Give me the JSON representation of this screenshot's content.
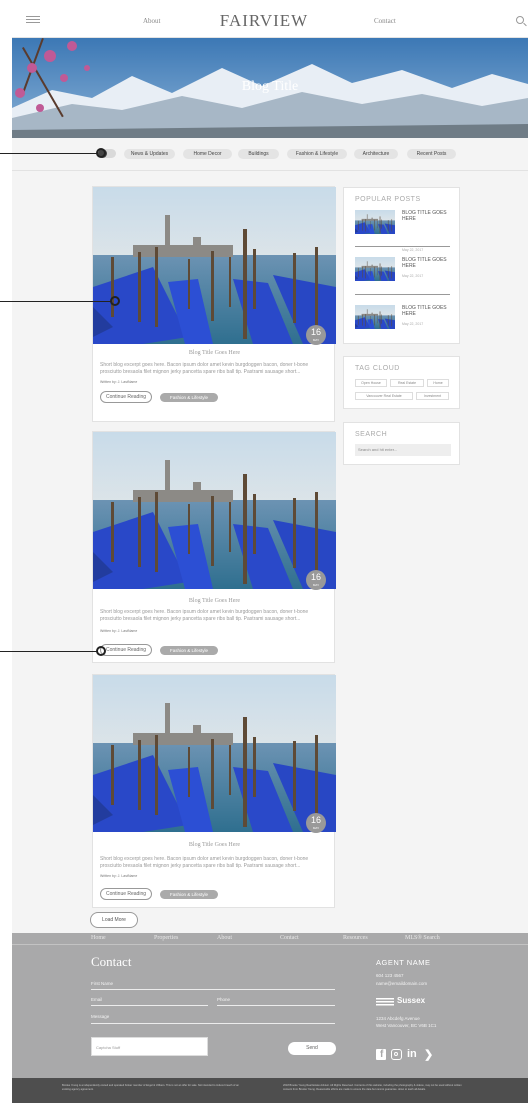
{
  "header": {
    "logo": "FAIRVIEW",
    "nav_left": "About",
    "nav_right": "Contact"
  },
  "hero": {
    "title": "Blog Title"
  },
  "filters": [
    "News & Updates",
    "Home Decor",
    "Buildings",
    "Fashion & Lifestyle",
    "Architecture",
    "Recent Posts"
  ],
  "posts": [
    {
      "title": "Blog Title Goes Here",
      "excerpt": "Short blog excerpt goes here. Bacon ipsum dolor amet kevin burgdoggen bacon, doner t-bone prosciutto bresaola filet mignon jerky pancetta spare ribs ball tip. Pastrami sausage short...",
      "author": "Written by: J. LastName",
      "day": "16",
      "month": "MAY",
      "button": "Continue Reading",
      "tag": "Fashion & Lifestyle"
    },
    {
      "title": "Blog Title Goes Here",
      "excerpt": "Short blog excerpt goes here. Bacon ipsum dolor amet kevin burgdoggen bacon, doner t-bone prosciutto bresaola filet mignon jerky pancetta spare ribs ball tip. Pastrami sausage short...",
      "author": "Written by: J. LastName",
      "day": "16",
      "month": "MAY",
      "button": "Continue Reading",
      "tag": "Fashion & Lifestyle"
    },
    {
      "title": "Blog Title Goes Here",
      "excerpt": "Short blog excerpt goes here. Bacon ipsum dolor amet kevin burgdoggen bacon, doner t-bone prosciutto bresaola filet mignon jerky pancetta spare ribs ball tip. Pastrami sausage short...",
      "author": "Written by: J. LastName",
      "day": "16",
      "month": "MAY",
      "button": "Continue Reading",
      "tag": "Fashion & Lifestyle"
    }
  ],
  "sidebar": {
    "popular_title": "POPULAR POSTS",
    "popular": [
      {
        "title": "BLOG TITLE GOES HERE",
        "date": "May 22, 2017"
      },
      {
        "title": "BLOG TITLE GOES HERE",
        "date": "May 22, 2017"
      },
      {
        "title": "BLOG TITLE GOES HERE",
        "date": "May 22, 2017"
      }
    ],
    "tag_cloud_title": "TAG CLOUD",
    "tags": [
      "Open House",
      "Real Estate",
      "Home",
      "Vancouver Real Estate",
      "Investment"
    ],
    "search_title": "SEARCH",
    "search_placeholder": "Search and hit enter..."
  },
  "load_more": "Load More",
  "footer": {
    "nav": [
      "Home",
      "Properties",
      "About",
      "Contact",
      "Resources",
      "MLS® Search"
    ],
    "contact_title": "Contact",
    "first_name": "First Name",
    "email": "Email",
    "phone": "Phone",
    "message": "Message",
    "captcha": "Captcha Stuff",
    "send": "Send",
    "agent_name": "AGENT NAME",
    "phone_number": "604 123 4567",
    "agent_email": "name@emaildomain.com",
    "brokerage": "Sussex",
    "address1": "1234 Abcdefg Avenue",
    "address2": "West Vancouver, BC  V6B 1C1",
    "social": [
      "facebook-icon",
      "instagram-icon",
      "linkedin-icon",
      "twitter-icon"
    ],
    "legal_left": "Brooke Young is a independently owned and operated broker member of Engel & Völkers. This is not an offer for sale. Not intended to induce breach of an existing agency agreement.",
    "legal_right": "2018 Brooke Young Real Estate Advisor. All Rights Reserved. Contents of this website, including the photography & videos, may not be used without written consent from Brooke Young. Reasonable efforts are made to ensure the data but cannot guarantee. down to teeth all details."
  },
  "colors": {
    "footer": "#a9a9aa",
    "bottom_bar": "#4e4e4e",
    "pill": "#e4e4e4",
    "tag": "#aaaaaa"
  }
}
